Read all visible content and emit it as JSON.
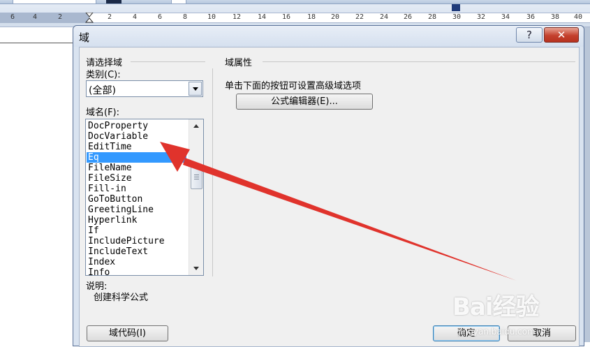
{
  "ruler": {
    "ticks": [
      "6",
      "4",
      "2",
      "2",
      "4",
      "6",
      "8",
      "10",
      "12",
      "14",
      "16",
      "18",
      "20",
      "22",
      "24",
      "26",
      "28",
      "30",
      "32",
      "34",
      "36",
      "38",
      "40"
    ]
  },
  "dialog": {
    "title": "域",
    "help_label": "?",
    "close_label": "✕",
    "select_field_heading": "请选择域",
    "category_label": "类别(C):",
    "category_value": "(全部)",
    "field_names_label": "域名(F):",
    "field_names": [
      "DocProperty",
      "DocVariable",
      "EditTime",
      "Eq",
      "FileName",
      "FileSize",
      "Fill-in",
      "GoToButton",
      "GreetingLine",
      "Hyperlink",
      "If",
      "IncludePicture",
      "IncludeText",
      "Index",
      "Info"
    ],
    "selected_field": "Eq",
    "description_label": "说明:",
    "description_text": "创建科学公式",
    "field_properties_heading": "域属性",
    "advanced_hint": "单击下面的按钮可设置高级域选项",
    "formula_editor_button": "公式编辑器(E)...",
    "field_codes_button": "域代码(I)",
    "ok_button": "确定",
    "cancel_button": "取消"
  },
  "annotation": {
    "arrow_color": "#e0332c"
  },
  "watermark": {
    "logo": "Bai经验",
    "url": "jingyan.baidu.com"
  }
}
